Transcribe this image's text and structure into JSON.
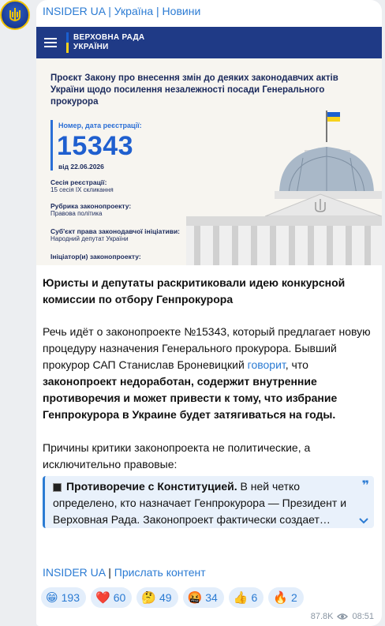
{
  "channel": {
    "name": "INSIDER UA | Україна | Новини"
  },
  "image": {
    "banner_line1": "ВЕРХОВНА РАДА",
    "banner_line2": "УКРАЇНИ",
    "bill_title": "Проєкт Закону про внесення змін до деяких законодавчих актів України щодо посилення незалежності посади Генерального прокурора",
    "reg_label": "Номер, дата реєстрації:",
    "reg_number": "15343",
    "reg_date": "від 22.06.2026",
    "session_label": "Сесія реєстрації:",
    "session_value": "15 сесія IX скликання",
    "rubric_label": "Рубрика законопроекту:",
    "rubric_value": "Правова політика",
    "subject_label": "Суб'єкт права законодавчої ініціативи:",
    "subject_value": "Народний депутат України",
    "initiator_label": "Ініціатор(и) законопроекту:"
  },
  "post": {
    "title": "Юристы и депутаты раскритиковали идею конкурсной комиссии по отбору Генпрокурора",
    "p1_text1": "Речь идёт о законопроекте №15343, который предлагает новую процедуру назначения Генерального прокурора. Бывший прокурор САП Станислав Броневицкий ",
    "p1_link": "говорит",
    "p1_text2": ", что ",
    "p1_bold": "законопроект недоработан, содержит внутренние противоречия и может привести к тому, что избрание Генпрокурора в Украине будет затягиваться на годы.",
    "p2": "Причины критики законопроекта не политические, а исключительно правовые:",
    "quote_bold": "Противоречие с Конституцией.",
    "quote_text": " В ней четко определено, кто назначает Генпрокурора — Президент и Верховная Рада. Законопроект фактически создает…"
  },
  "footer": {
    "link1": "INSIDER UA",
    "sep": "|",
    "link2": "Прислать контент"
  },
  "reactions": [
    {
      "emoji": "😁",
      "count": "193"
    },
    {
      "emoji": "❤️",
      "count": "60"
    },
    {
      "emoji": "🤔",
      "count": "49"
    },
    {
      "emoji": "🤬",
      "count": "34"
    },
    {
      "emoji": "👍",
      "count": "6"
    },
    {
      "emoji": "🔥",
      "count": "2"
    }
  ],
  "stats": {
    "views": "87.8K",
    "time": "08:51"
  },
  "colors": {
    "accent": "#2b7bd3",
    "rada_blue": "#1f3a86",
    "flag_blue": "#1a5fd0",
    "flag_yellow": "#f7d21c"
  }
}
